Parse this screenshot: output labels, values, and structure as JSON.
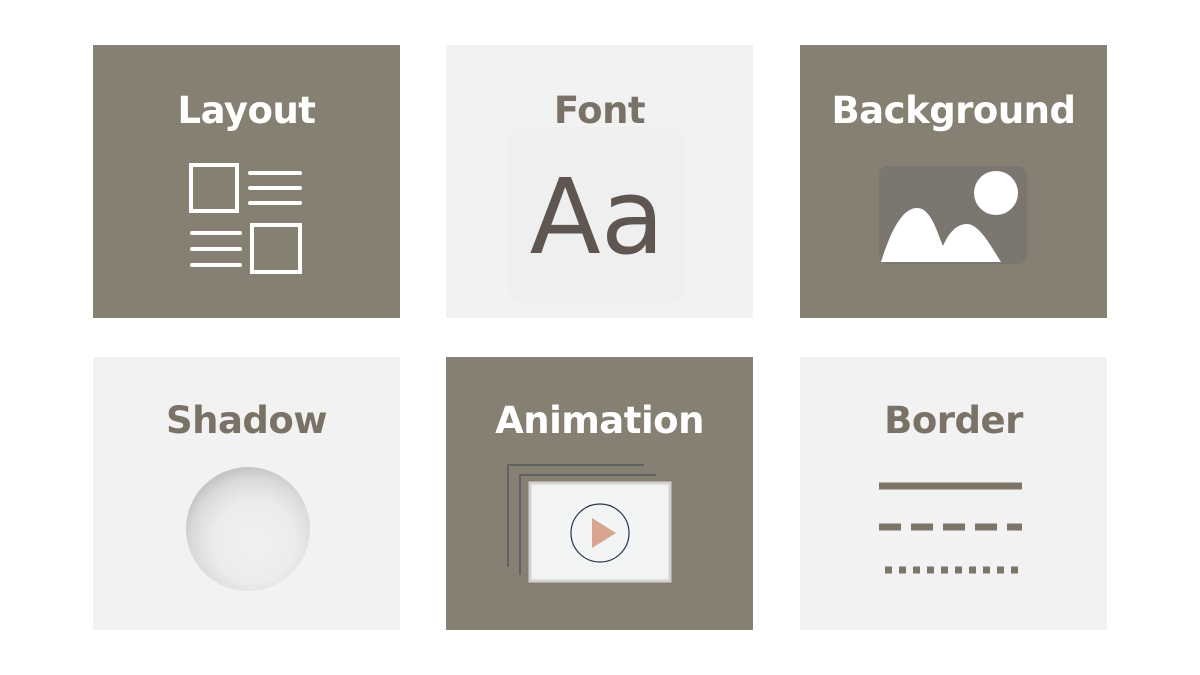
{
  "tiles": [
    {
      "id": "layout",
      "title": "Layout",
      "theme": "dark",
      "icon": "layout-icon"
    },
    {
      "id": "font",
      "title": "Font",
      "theme": "light",
      "icon": "font-icon",
      "glyph": "Aa"
    },
    {
      "id": "background",
      "title": "Background",
      "theme": "dark",
      "icon": "image-icon"
    },
    {
      "id": "shadow",
      "title": "Shadow",
      "theme": "light",
      "icon": "shadow-icon"
    },
    {
      "id": "animation",
      "title": "Animation",
      "theme": "dark",
      "icon": "play-icon"
    },
    {
      "id": "border",
      "title": "Border",
      "theme": "light",
      "icon": "border-styles-icon"
    }
  ],
  "colors": {
    "dark_tile": "#868073",
    "light_tile": "#f2f2f2",
    "dark_text": "#7a7266",
    "glyph": "#5f5652",
    "play_accent": "#d8a590",
    "border_lines": "#7d7568"
  }
}
